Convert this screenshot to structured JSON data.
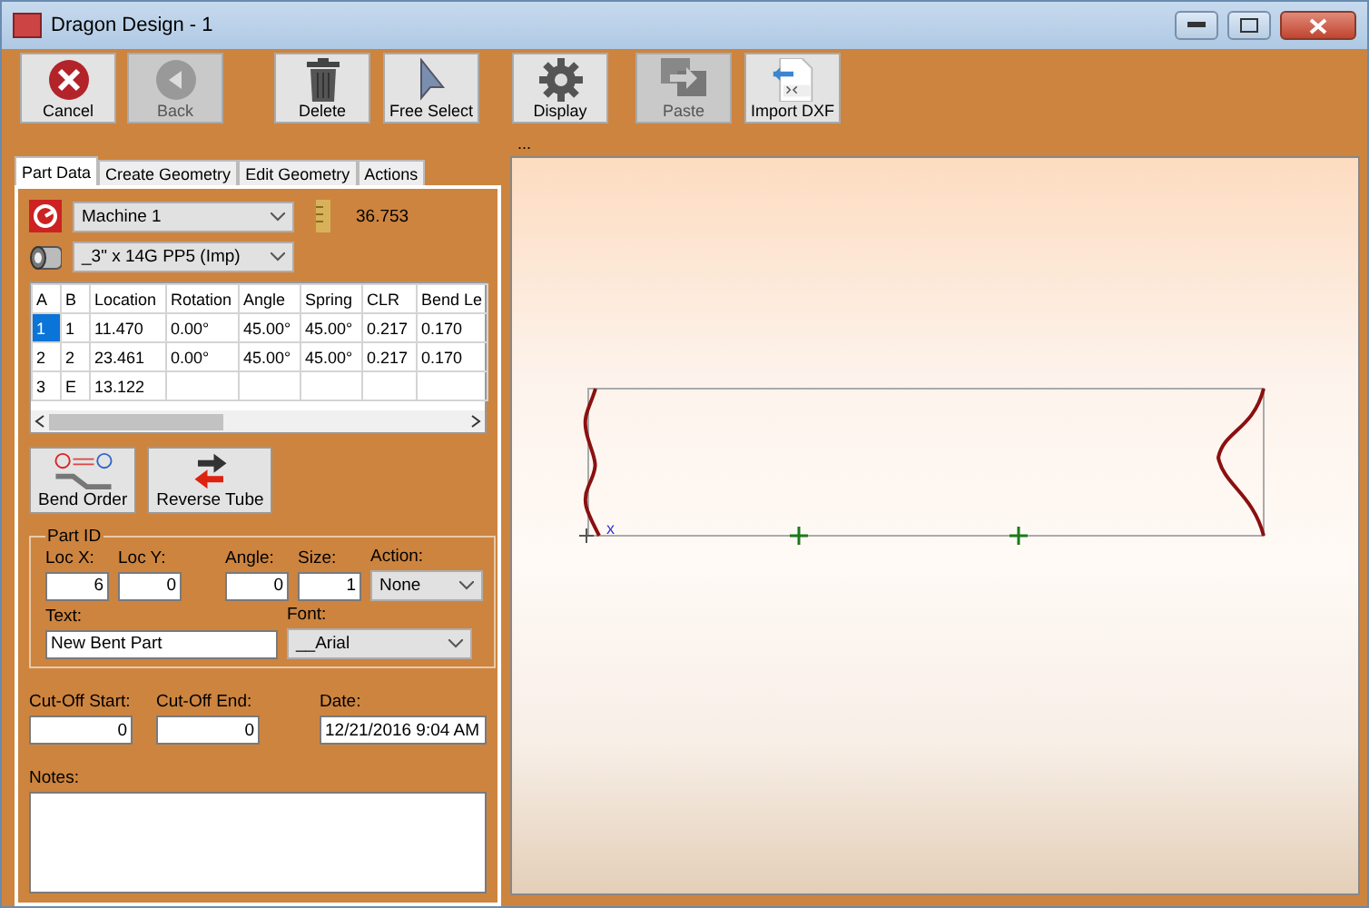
{
  "window": {
    "title": "Dragon Design - 1"
  },
  "toolbar": [
    {
      "label": "Cancel",
      "kind": "cancel",
      "disabled": false
    },
    {
      "label": "Back",
      "kind": "back",
      "disabled": true
    },
    {
      "label": "Delete",
      "kind": "delete",
      "disabled": false
    },
    {
      "label": "Free Select",
      "kind": "select",
      "disabled": false
    },
    {
      "label": "Display",
      "kind": "display",
      "disabled": false
    },
    {
      "label": "Paste",
      "kind": "paste",
      "disabled": true
    },
    {
      "label": "Import DXF",
      "kind": "import",
      "disabled": false
    }
  ],
  "tabs": [
    {
      "label": "Part Data",
      "selected": true
    },
    {
      "label": "Create Geometry",
      "selected": false
    },
    {
      "label": "Edit Geometry",
      "selected": false
    },
    {
      "label": "Actions",
      "selected": false
    }
  ],
  "machine": {
    "value": "Machine 1"
  },
  "length_reading": "36.753",
  "tube": {
    "value": "_3\" x 14G PP5 (Imp)"
  },
  "table": {
    "columns": [
      "A",
      "B",
      "Location",
      "Rotation",
      "Angle",
      "Spring",
      "CLR",
      "Bend Le"
    ],
    "rows": [
      {
        "cells": [
          "1",
          "1",
          "11.470",
          "0.00°",
          "45.00°",
          "45.00°",
          "0.217",
          "0.170"
        ],
        "selected": true
      },
      {
        "cells": [
          "2",
          "2",
          "23.461",
          "0.00°",
          "45.00°",
          "45.00°",
          "0.217",
          "0.170"
        ],
        "selected": false
      },
      {
        "cells": [
          "3",
          "E",
          "13.122",
          "",
          "",
          "",
          "",
          ""
        ],
        "selected": false
      }
    ]
  },
  "actions": [
    {
      "label": "Bend Order",
      "kind": "order"
    },
    {
      "label": "Reverse Tube",
      "kind": "reverse"
    }
  ],
  "part_id": {
    "title": "Part ID",
    "loc_x": {
      "label": "Loc X:",
      "value": "6"
    },
    "loc_y": {
      "label": "Loc Y:",
      "value": "0"
    },
    "angle": {
      "label": "Angle:",
      "value": "0"
    },
    "size": {
      "label": "Size:",
      "value": "1"
    },
    "action": {
      "label": "Action:",
      "value": "None"
    },
    "text": {
      "label": "Text:",
      "value": "New Bent Part"
    },
    "font": {
      "label": "Font:",
      "value": "__Arial"
    }
  },
  "cut_off_start": {
    "label": "Cut-Off Start:",
    "value": "0"
  },
  "cut_off_end": {
    "label": "Cut-Off End:",
    "value": "0"
  },
  "date": {
    "label": "Date:",
    "value": "12/21/2016 9:04 AM"
  },
  "notes": {
    "label": "Notes:"
  },
  "canvas": {
    "caption": "...",
    "origin_label": "x"
  }
}
